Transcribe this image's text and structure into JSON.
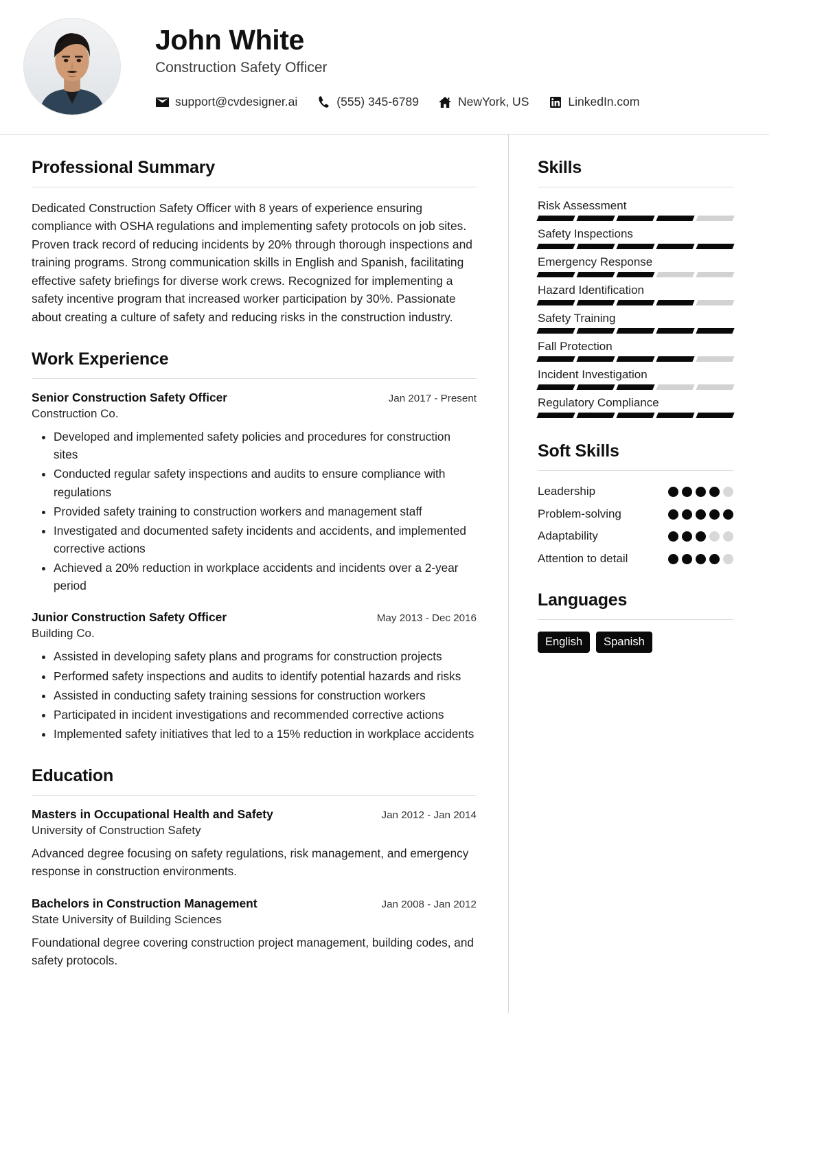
{
  "header": {
    "name": "John White",
    "job_title": "Construction Safety Officer",
    "avatar_alt": "profile-photo",
    "contacts": [
      {
        "icon": "envelope-icon",
        "text": "support@cvdesigner.ai"
      },
      {
        "icon": "phone-icon",
        "text": "(555) 345-6789"
      },
      {
        "icon": "home-icon",
        "text": "NewYork, US"
      },
      {
        "icon": "linkedin-icon",
        "text": "LinkedIn.com"
      }
    ]
  },
  "main": {
    "summary": {
      "title": "Professional Summary",
      "text": "Dedicated Construction Safety Officer with 8 years of experience ensuring compliance with OSHA regulations and implementing safety protocols on job sites. Proven track record of reducing incidents by 20% through thorough inspections and training programs. Strong communication skills in English and Spanish, facilitating effective safety briefings for diverse work crews. Recognized for implementing a safety incentive program that increased worker participation by 30%. Passionate about creating a culture of safety and reducing risks in the construction industry."
    },
    "experience": {
      "title": "Work Experience",
      "entries": [
        {
          "role": "Senior Construction Safety Officer",
          "date": "Jan 2017 - Present",
          "company": "Construction Co.",
          "bullets": [
            "Developed and implemented safety policies and procedures for construction sites",
            "Conducted regular safety inspections and audits to ensure compliance with regulations",
            "Provided safety training to construction workers and management staff",
            "Investigated and documented safety incidents and accidents, and implemented corrective actions",
            "Achieved a 20% reduction in workplace accidents and incidents over a 2-year period"
          ]
        },
        {
          "role": "Junior Construction Safety Officer",
          "date": "May 2013 - Dec 2016",
          "company": "Building Co.",
          "bullets": [
            "Assisted in developing safety plans and programs for construction projects",
            "Performed safety inspections and audits to identify potential hazards and risks",
            "Assisted in conducting safety training sessions for construction workers",
            "Participated in incident investigations and recommended corrective actions",
            "Implemented safety initiatives that led to a 15% reduction in workplace accidents"
          ]
        }
      ]
    },
    "education": {
      "title": "Education",
      "entries": [
        {
          "degree": "Masters in Occupational Health and Safety",
          "date": "Jan 2012 - Jan 2014",
          "school": "University of Construction Safety",
          "description": "Advanced degree focusing on safety regulations, risk management, and emergency response in construction environments."
        },
        {
          "degree": "Bachelors in Construction Management",
          "date": "Jan 2008 - Jan 2012",
          "school": "State University of Building Sciences",
          "description": "Foundational degree covering construction project management, building codes, and safety protocols."
        }
      ]
    }
  },
  "sidebar": {
    "skills": {
      "title": "Skills",
      "max": 5,
      "items": [
        {
          "label": "Risk Assessment",
          "level": 4
        },
        {
          "label": "Safety Inspections",
          "level": 5
        },
        {
          "label": "Emergency Response",
          "level": 3
        },
        {
          "label": "Hazard Identification",
          "level": 4
        },
        {
          "label": "Safety Training",
          "level": 5
        },
        {
          "label": "Fall Protection",
          "level": 4
        },
        {
          "label": "Incident Investigation",
          "level": 3
        },
        {
          "label": "Regulatory Compliance",
          "level": 5
        }
      ]
    },
    "soft_skills": {
      "title": "Soft Skills",
      "max": 5,
      "items": [
        {
          "label": "Leadership",
          "level": 4
        },
        {
          "label": "Problem-solving",
          "level": 5
        },
        {
          "label": "Adaptability",
          "level": 3
        },
        {
          "label": "Attention to detail",
          "level": 4
        }
      ]
    },
    "languages": {
      "title": "Languages",
      "items": [
        "English",
        "Spanish"
      ]
    }
  },
  "colors": {
    "accent": "#0a0a0a",
    "bar_empty": "#d2d2d2",
    "text": "#1f1f1f",
    "rule": "#dcdcdc"
  }
}
